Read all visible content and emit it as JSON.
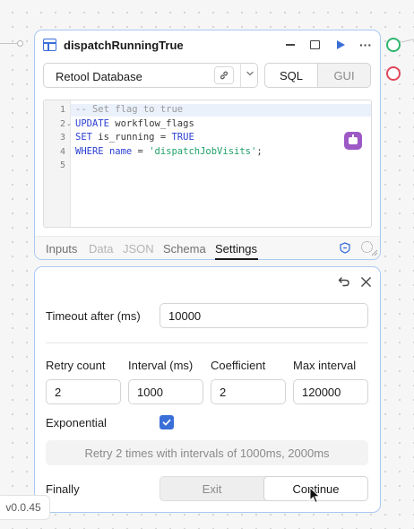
{
  "query_block": {
    "title": "dispatchRunningTrue",
    "resource": "Retool Database",
    "mode_options": [
      "SQL",
      "GUI"
    ],
    "active_mode": "SQL",
    "code_lines": [
      {
        "n": "1",
        "fold": "",
        "tokens": [
          {
            "t": "-- Set flag to true",
            "k": "comment"
          }
        ]
      },
      {
        "n": "2",
        "fold": "⌄",
        "tokens": [
          {
            "t": "UPDATE",
            "k": "kw"
          },
          {
            "t": " workflow_flags",
            "k": "id"
          }
        ]
      },
      {
        "n": "3",
        "fold": "",
        "tokens": [
          {
            "t": "SET",
            "k": "kw"
          },
          {
            "t": " is_running = ",
            "k": "id"
          },
          {
            "t": "TRUE",
            "k": "bool"
          }
        ]
      },
      {
        "n": "4",
        "fold": "",
        "tokens": [
          {
            "t": "WHERE",
            "k": "kw"
          },
          {
            "t": " ",
            "k": "id"
          },
          {
            "t": "name",
            "k": "kw"
          },
          {
            "t": " = ",
            "k": "id"
          },
          {
            "t": "'dispatchJobVisits'",
            "k": "str"
          },
          {
            "t": ";",
            "k": "id"
          }
        ]
      },
      {
        "n": "5",
        "fold": "",
        "tokens": []
      }
    ],
    "tabs": [
      {
        "label": "Inputs",
        "state": "normal"
      },
      {
        "label": "Data",
        "state": "disabled"
      },
      {
        "label": "JSON",
        "state": "disabled"
      },
      {
        "label": "Schema",
        "state": "normal"
      },
      {
        "label": "Settings",
        "state": "active"
      }
    ]
  },
  "settings": {
    "timeout_label": "Timeout after (ms)",
    "timeout_value": "10000",
    "retry_count_label": "Retry count",
    "retry_count_value": "2",
    "interval_label": "Interval (ms)",
    "interval_value": "1000",
    "coefficient_label": "Coefficient",
    "coefficient_value": "2",
    "max_interval_label": "Max interval",
    "max_interval_value": "120000",
    "exponential_label": "Exponential",
    "exponential_checked": true,
    "retry_summary": "Retry 2 times with intervals of 1000ms, 2000ms",
    "finally_label": "Finally",
    "finally_options": [
      "Exit",
      "Continue"
    ],
    "finally_selected": "Continue"
  },
  "version": "v0.0.45",
  "colors": {
    "accent": "#3b6fd8",
    "block_border": "#a9c9f2",
    "success_port": "#2fb56f",
    "error_port": "#e0475b",
    "ai_assist": "#9d59c6"
  }
}
